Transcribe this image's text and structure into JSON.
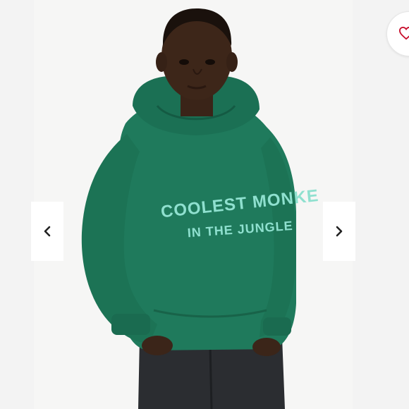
{
  "listing": {
    "photo_alt": "Child wearing green hoodie",
    "garment_print": {
      "line1": "COOLEST MONKE",
      "line2": "IN THE JUNGLE"
    }
  },
  "controls": {
    "prev_icon": "chevron-left-icon",
    "next_icon": "chevron-right-icon",
    "like_icon": "heart-outline-icon"
  },
  "colors": {
    "hoodie": "#1f7a5c",
    "print": "#8fe0cf",
    "like_accent": "#c8102e"
  }
}
